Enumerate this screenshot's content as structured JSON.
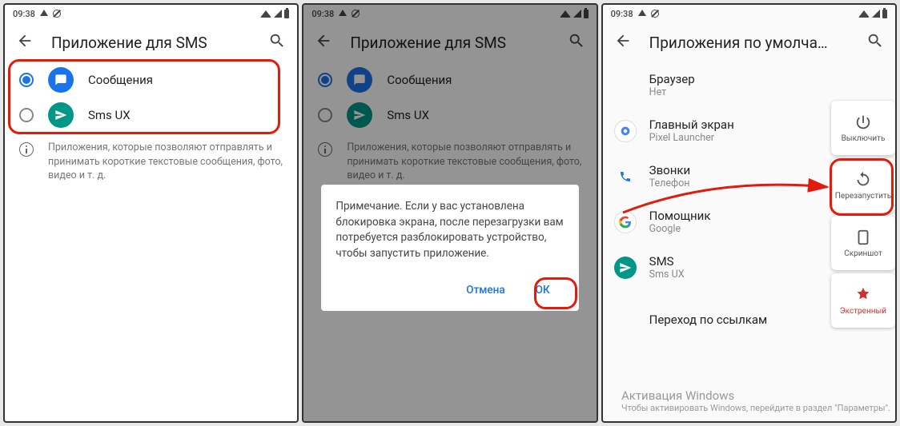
{
  "status": {
    "time": "09:38"
  },
  "screen1": {
    "title": "Приложение для SMS",
    "apps": [
      {
        "label": "Сообщения",
        "selected": true,
        "iconColor": "blue"
      },
      {
        "label": "Sms UX",
        "selected": false,
        "iconColor": "teal"
      }
    ],
    "info": "Приложения, которые позволяют отправлять и принимать короткие текстовые сообщения, фото, видео и т. д."
  },
  "screen2": {
    "title": "Приложение для SMS",
    "apps": [
      {
        "label": "Сообщения",
        "selected": true,
        "iconColor": "blue"
      },
      {
        "label": "Sms UX",
        "selected": false,
        "iconColor": "teal"
      }
    ],
    "info": "Приложения, которые позволяют отправлять и принимать короткие текстовые сообщения, фото, видео и т. д.",
    "dialog": {
      "text": "Примечание. Если у вас установлена блокировка экрана, после перезагрузки вам потребуется разблокировать устройство, чтобы запустить приложение.",
      "cancel": "Отмена",
      "ok": "ОК"
    }
  },
  "screen3": {
    "title": "Приложения по умолча…",
    "rows": [
      {
        "title": "Браузер",
        "sub": "Нет",
        "icon": null
      },
      {
        "title": "Главный экран",
        "sub": "Pixel Launcher",
        "icon": "google"
      },
      {
        "title": "Звонки",
        "sub": "Телефон",
        "icon": "phone"
      },
      {
        "title": "Помощник",
        "sub": "Google",
        "icon": "google"
      },
      {
        "title": "SMS",
        "sub": "Sms UX",
        "icon": "smsux"
      },
      {
        "title": "Переход по ссылкам",
        "sub": null,
        "icon": null
      }
    ],
    "power": [
      {
        "label": "Выключить",
        "icon": "power"
      },
      {
        "label": "Перезапустить",
        "icon": "restart"
      },
      {
        "label": "Скриншот",
        "icon": "screenshot"
      },
      {
        "label": "Экстренный",
        "icon": "emergency"
      }
    ]
  },
  "watermark": {
    "line1": "Активация Windows",
    "line2": "Чтобы активировать Windows, перейдите в раздел \"Параметры\"."
  }
}
